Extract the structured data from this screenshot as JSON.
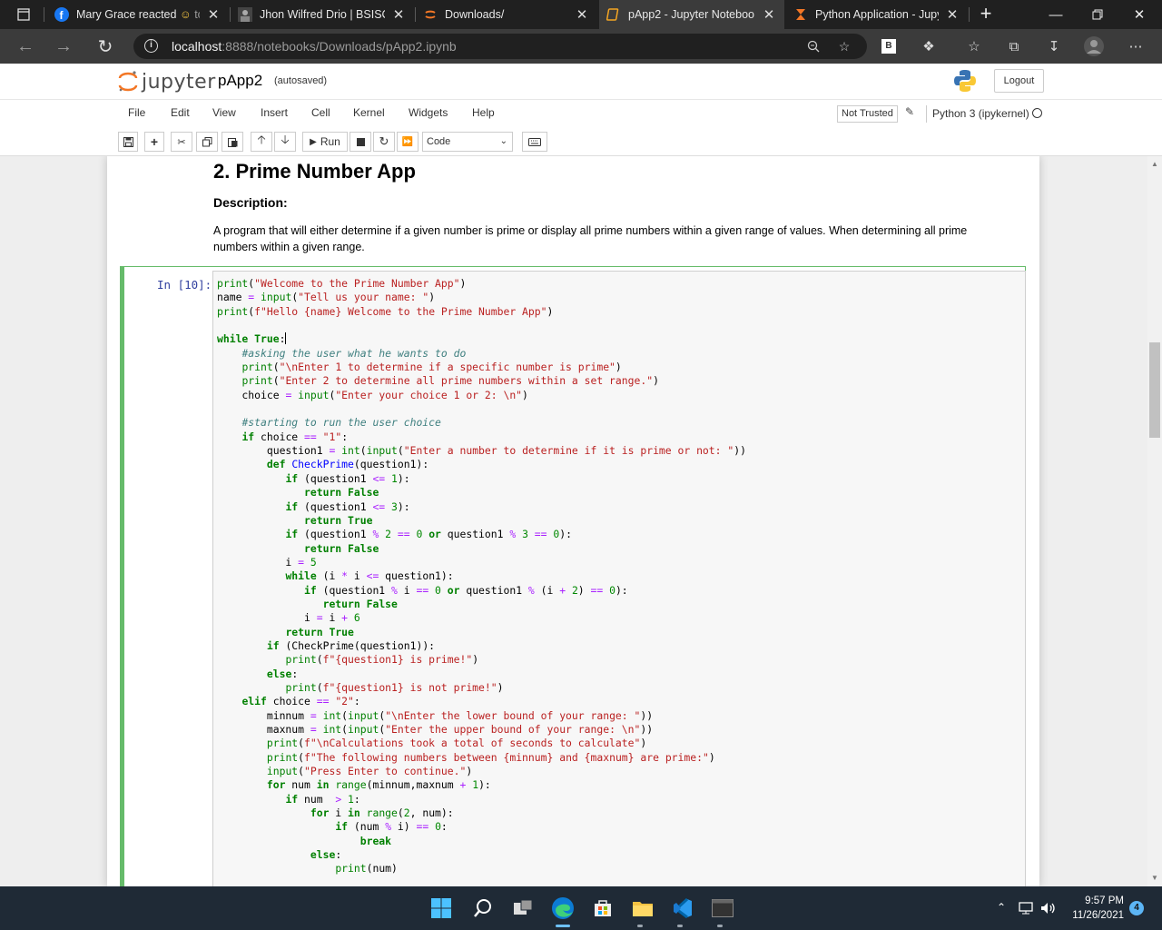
{
  "browser": {
    "tabs": [
      {
        "label": "Mary Grace reacted",
        "extra": "to",
        "icon": "facebook-icon"
      },
      {
        "label": "Jhon Wilfred Drio | BSISCS",
        "icon": "profile-icon"
      },
      {
        "label": "Downloads/",
        "icon": "jupyter-icon"
      },
      {
        "label": "pApp2 - Jupyter Noteboo",
        "icon": "notebook-icon"
      },
      {
        "label": "Python Application - Jupy",
        "icon": "hourglass-icon"
      }
    ],
    "url_host": "localhost",
    "url_path": ":8888/notebooks/Downloads/pApp2.ipynb",
    "profile_badge": "B"
  },
  "jupyter": {
    "wordmark": "jupyter",
    "notebook_name": "pApp2",
    "autosave": "(autosaved)",
    "logout": "Logout",
    "menu": [
      "File",
      "Edit",
      "View",
      "Insert",
      "Cell",
      "Kernel",
      "Widgets",
      "Help"
    ],
    "not_trusted": "Not Trusted",
    "kernel": "Python 3 (ipykernel)",
    "toolbar": {
      "run": "Run",
      "cell_type": "Code"
    }
  },
  "markdown": {
    "title": "2. Prime Number App",
    "desc_heading": "Description:",
    "desc": "A program that will either determine if a given number is prime or display all prime numbers within a given range of values. When determining all prime numbers within a given range."
  },
  "cell": {
    "prompt": "In [10]:"
  },
  "taskbar": {
    "time": "9:57 PM",
    "date": "11/26/2021",
    "notifications": "4"
  },
  "colors": {
    "cell_border": "#66bb6a",
    "prompt": "#303f9f",
    "taskbar": "#1f2a36"
  }
}
